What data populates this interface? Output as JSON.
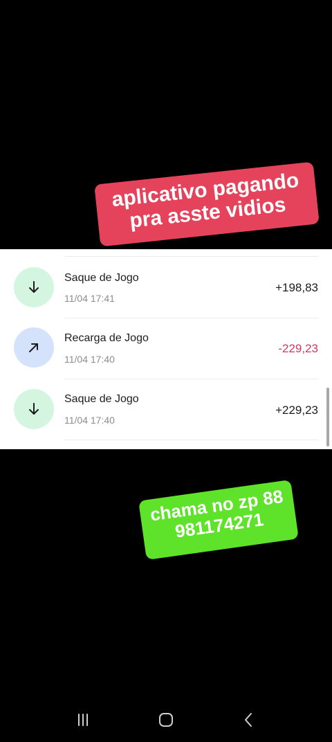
{
  "transactions": [
    {
      "title": "Saque de Jogo",
      "time": "11/04 17:41",
      "amount": "+198,83",
      "type": "withdraw"
    },
    {
      "title": "Recarga de Jogo",
      "time": "11/04 17:40",
      "amount": "-229,23",
      "type": "recharge"
    },
    {
      "title": "Saque de Jogo",
      "time": "11/04 17:40",
      "amount": "+229,23",
      "type": "withdraw"
    }
  ],
  "overlays": {
    "red_line1": "aplicativo pagando",
    "red_line2": "pra asste vidios",
    "green_line1": "chama no zp 88",
    "green_line2": "981174271"
  },
  "colors": {
    "withdraw_circle": "#d4f6e0",
    "recharge_circle": "#d5e2fb",
    "negative_amount": "#d2356a",
    "red_sticker": "#e5435c",
    "green_sticker": "#5ee32a"
  },
  "icons": {
    "withdraw": "arrow-down-icon",
    "recharge": "arrow-up-right-icon",
    "nav_recent": "recent-apps-icon",
    "nav_home": "home-icon",
    "nav_back": "back-icon"
  }
}
